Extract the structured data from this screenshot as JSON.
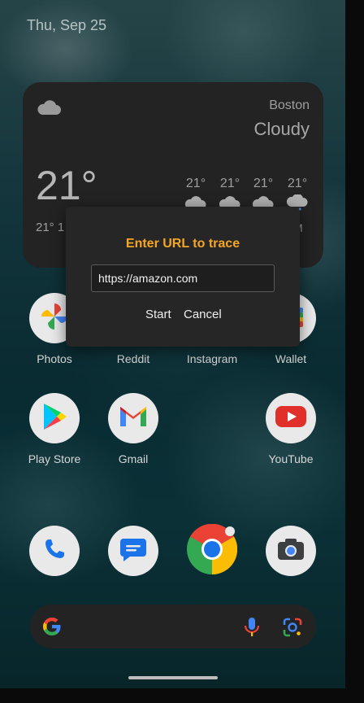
{
  "status_bar": {
    "date": "Thu, Sep 25"
  },
  "weather": {
    "icon": "cloud-icon",
    "city": "Boston",
    "condition": "Cloudy",
    "temperature": "21°",
    "low_partial": "21°  1",
    "forecast": [
      {
        "temp": "21°",
        "icon": "cloud-icon"
      },
      {
        "temp": "21°",
        "icon": "cloud-icon"
      },
      {
        "temp": "21°",
        "icon": "cloud-icon"
      },
      {
        "temp": "21°",
        "icon": "rain-cloud-icon",
        "label": "M"
      }
    ]
  },
  "dialog": {
    "title": "Enter URL to trace",
    "url_value": "https://amazon.com",
    "start_label": "Start",
    "cancel_label": "Cancel",
    "title_color": "#f5a623"
  },
  "apps": {
    "row1": [
      "Photos",
      "Reddit",
      "Instagram",
      "Wallet"
    ],
    "row2": [
      "Play Store",
      "Gmail",
      "YouTube"
    ],
    "dock": [
      "Phone",
      "Messages",
      "Chrome",
      "Camera"
    ]
  },
  "search_bar": {
    "icons": [
      "google-g-icon",
      "microphone-icon",
      "lens-icon"
    ]
  }
}
